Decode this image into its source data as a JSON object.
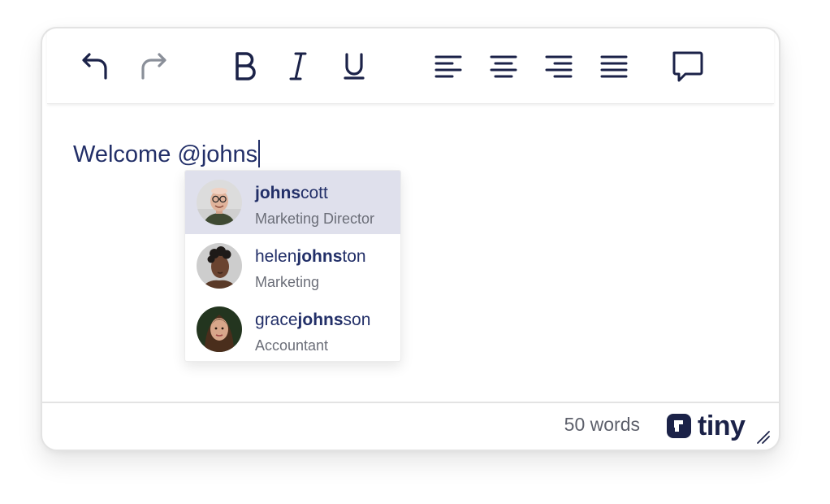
{
  "toolbar": {
    "buttons": [
      {
        "name": "undo-button",
        "icon": "undo-icon"
      },
      {
        "name": "redo-button",
        "icon": "redo-icon",
        "disabled": true
      },
      {
        "name": "bold-button",
        "icon": "bold-icon"
      },
      {
        "name": "italic-button",
        "icon": "italic-icon"
      },
      {
        "name": "underline-button",
        "icon": "underline-icon"
      },
      {
        "name": "align-left-button",
        "icon": "align-left-icon"
      },
      {
        "name": "align-center-button",
        "icon": "align-center-icon"
      },
      {
        "name": "align-right-button",
        "icon": "align-right-icon"
      },
      {
        "name": "justify-button",
        "icon": "justify-icon"
      },
      {
        "name": "comment-button",
        "icon": "comment-icon"
      }
    ]
  },
  "content": {
    "text": "Welcome @johns"
  },
  "mentions": {
    "query": "johns",
    "items": [
      {
        "prefix": "",
        "match": "johns",
        "suffix": "cott",
        "role": "Marketing Director",
        "selected": true
      },
      {
        "prefix": "helen",
        "match": "johns",
        "suffix": "ton",
        "role": "Marketing",
        "selected": false
      },
      {
        "prefix": "grace",
        "match": "johns",
        "suffix": "son",
        "role": "Accountant",
        "selected": false
      }
    ]
  },
  "statusbar": {
    "word_count": "50 words",
    "brand": "tiny"
  },
  "colors": {
    "text": "#222f68",
    "selected_row": "#dfe0ec",
    "icon": "#1b2248",
    "disabled_icon": "#8a8f99"
  }
}
